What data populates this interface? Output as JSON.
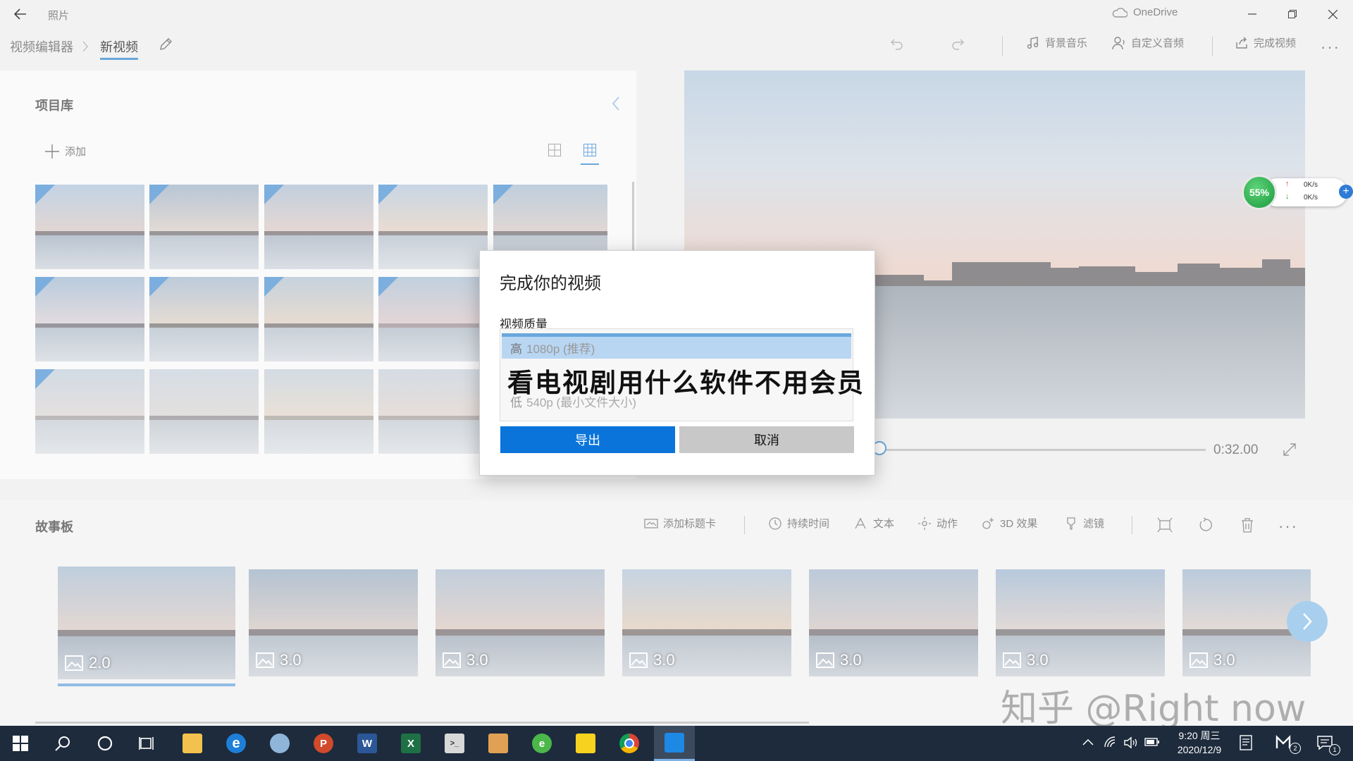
{
  "window": {
    "app_title": "照片",
    "onedrive_label": "OneDrive"
  },
  "header": {
    "breadcrumb_root": "视频编辑器",
    "breadcrumb_current": "新视频",
    "background_music": "背景音乐",
    "custom_audio": "自定义音频",
    "finish_video": "完成视频"
  },
  "library": {
    "title": "项目库",
    "add_label": "添加"
  },
  "player": {
    "duration": "0:32.00"
  },
  "net_widget": {
    "percent": "55%",
    "up": "0K/s",
    "down": "0K/s"
  },
  "dialog": {
    "title": "完成你的视频",
    "quality_label": "视频质量",
    "option_high_prefix": "高",
    "option_high_detail": "1080p (推荐)",
    "option_low_prefix": "低",
    "option_low_detail": "540p (最小文件大小)",
    "banner_text": "看电视剧用什么软件不用会员",
    "export_button": "导出",
    "cancel_button": "取消"
  },
  "storyboard": {
    "title": "故事板",
    "add_title_card": "添加标题卡",
    "duration": "持续时间",
    "text": "文本",
    "motion": "动作",
    "effects_3d": "3D 效果",
    "filters": "滤镜",
    "clips": [
      {
        "duration": "2.0"
      },
      {
        "duration": "3.0"
      },
      {
        "duration": "3.0"
      },
      {
        "duration": "3.0"
      },
      {
        "duration": "3.0"
      },
      {
        "duration": "3.0"
      },
      {
        "duration": "3.0"
      }
    ]
  },
  "watermark": "知乎 @Right now",
  "taskbar": {
    "time": "9:20 周三",
    "date": "2020/12/9",
    "notification_count": "1",
    "badge_count": "2"
  },
  "colors": {
    "accent": "#0a74da",
    "taskbar": "#1d2b3c",
    "cancel_bg": "#c8c8c8",
    "selected_option": "#b8d6f2"
  }
}
